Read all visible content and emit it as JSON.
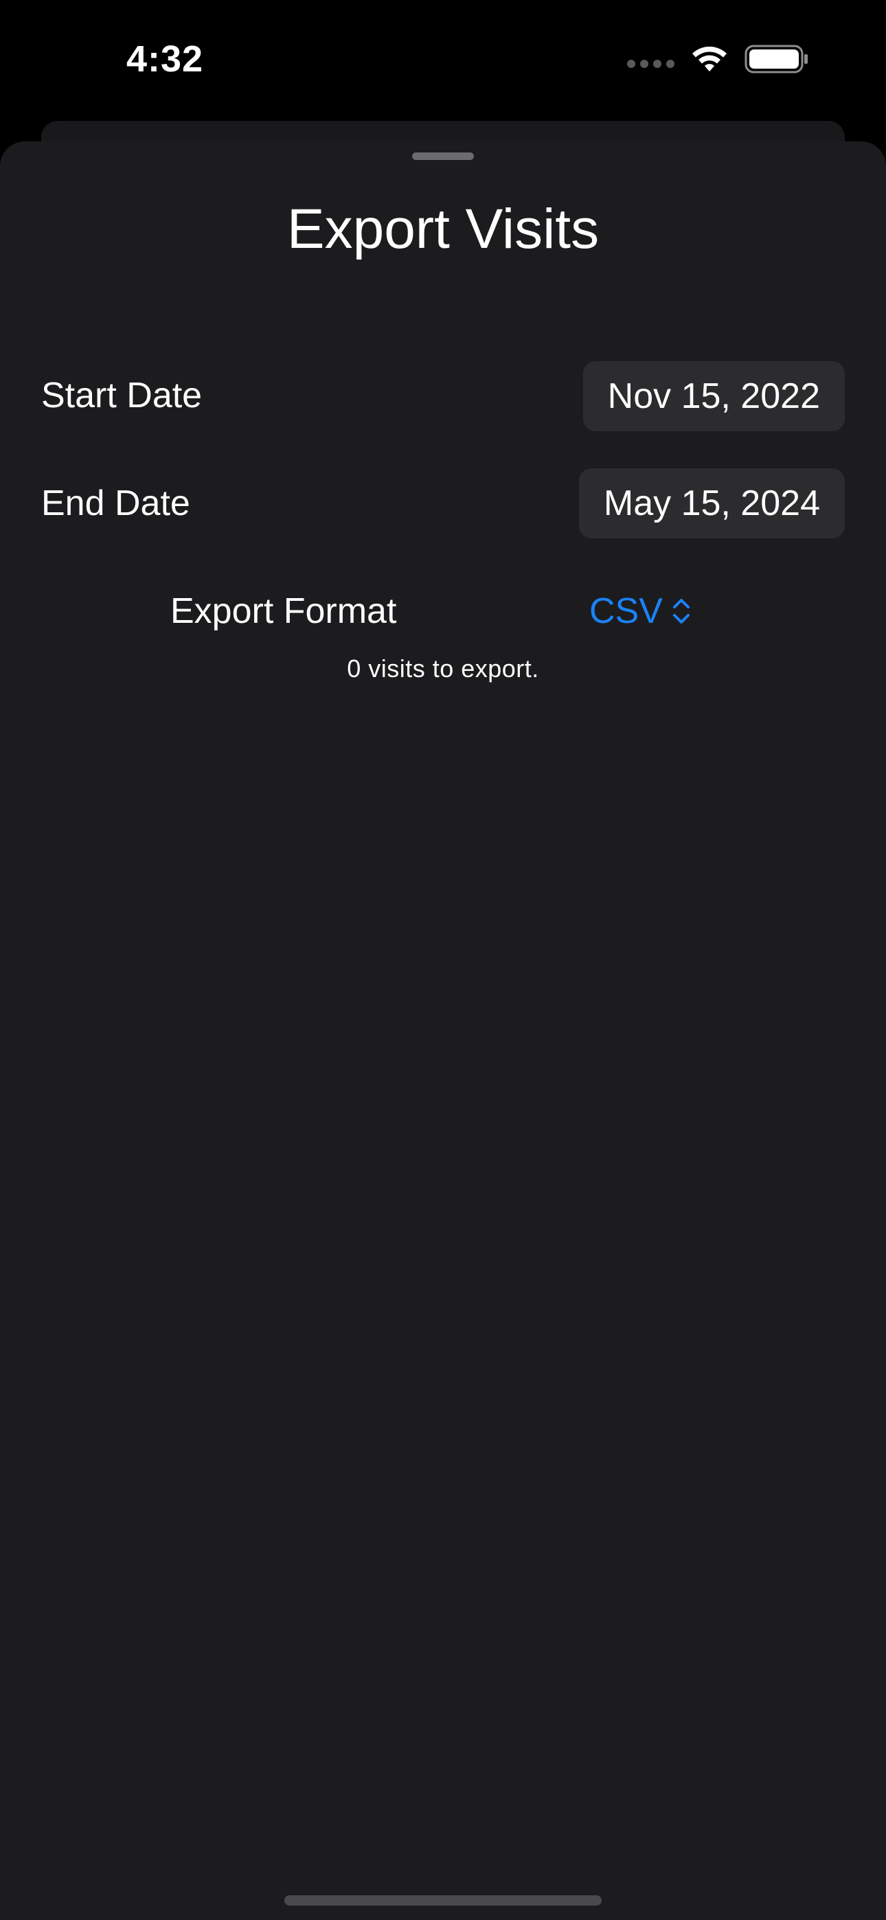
{
  "status_bar": {
    "time": "4:32",
    "icons": [
      "cellular-signal-icon",
      "wifi-icon",
      "battery-icon"
    ]
  },
  "sheet": {
    "title": "Export Visits",
    "start_date": {
      "label": "Start Date",
      "value": "Nov 15, 2022"
    },
    "end_date": {
      "label": "End Date",
      "value": "May 15, 2024"
    },
    "export_format": {
      "label": "Export Format",
      "value": "CSV",
      "icon": "chevron-up-down-icon"
    },
    "summary": "0 visits to export."
  },
  "colors": {
    "background": "#000000",
    "sheet_background": "#1c1c1e",
    "pill_background": "#2c2c2e",
    "accent": "#1a82f7",
    "text": "#ffffff"
  }
}
